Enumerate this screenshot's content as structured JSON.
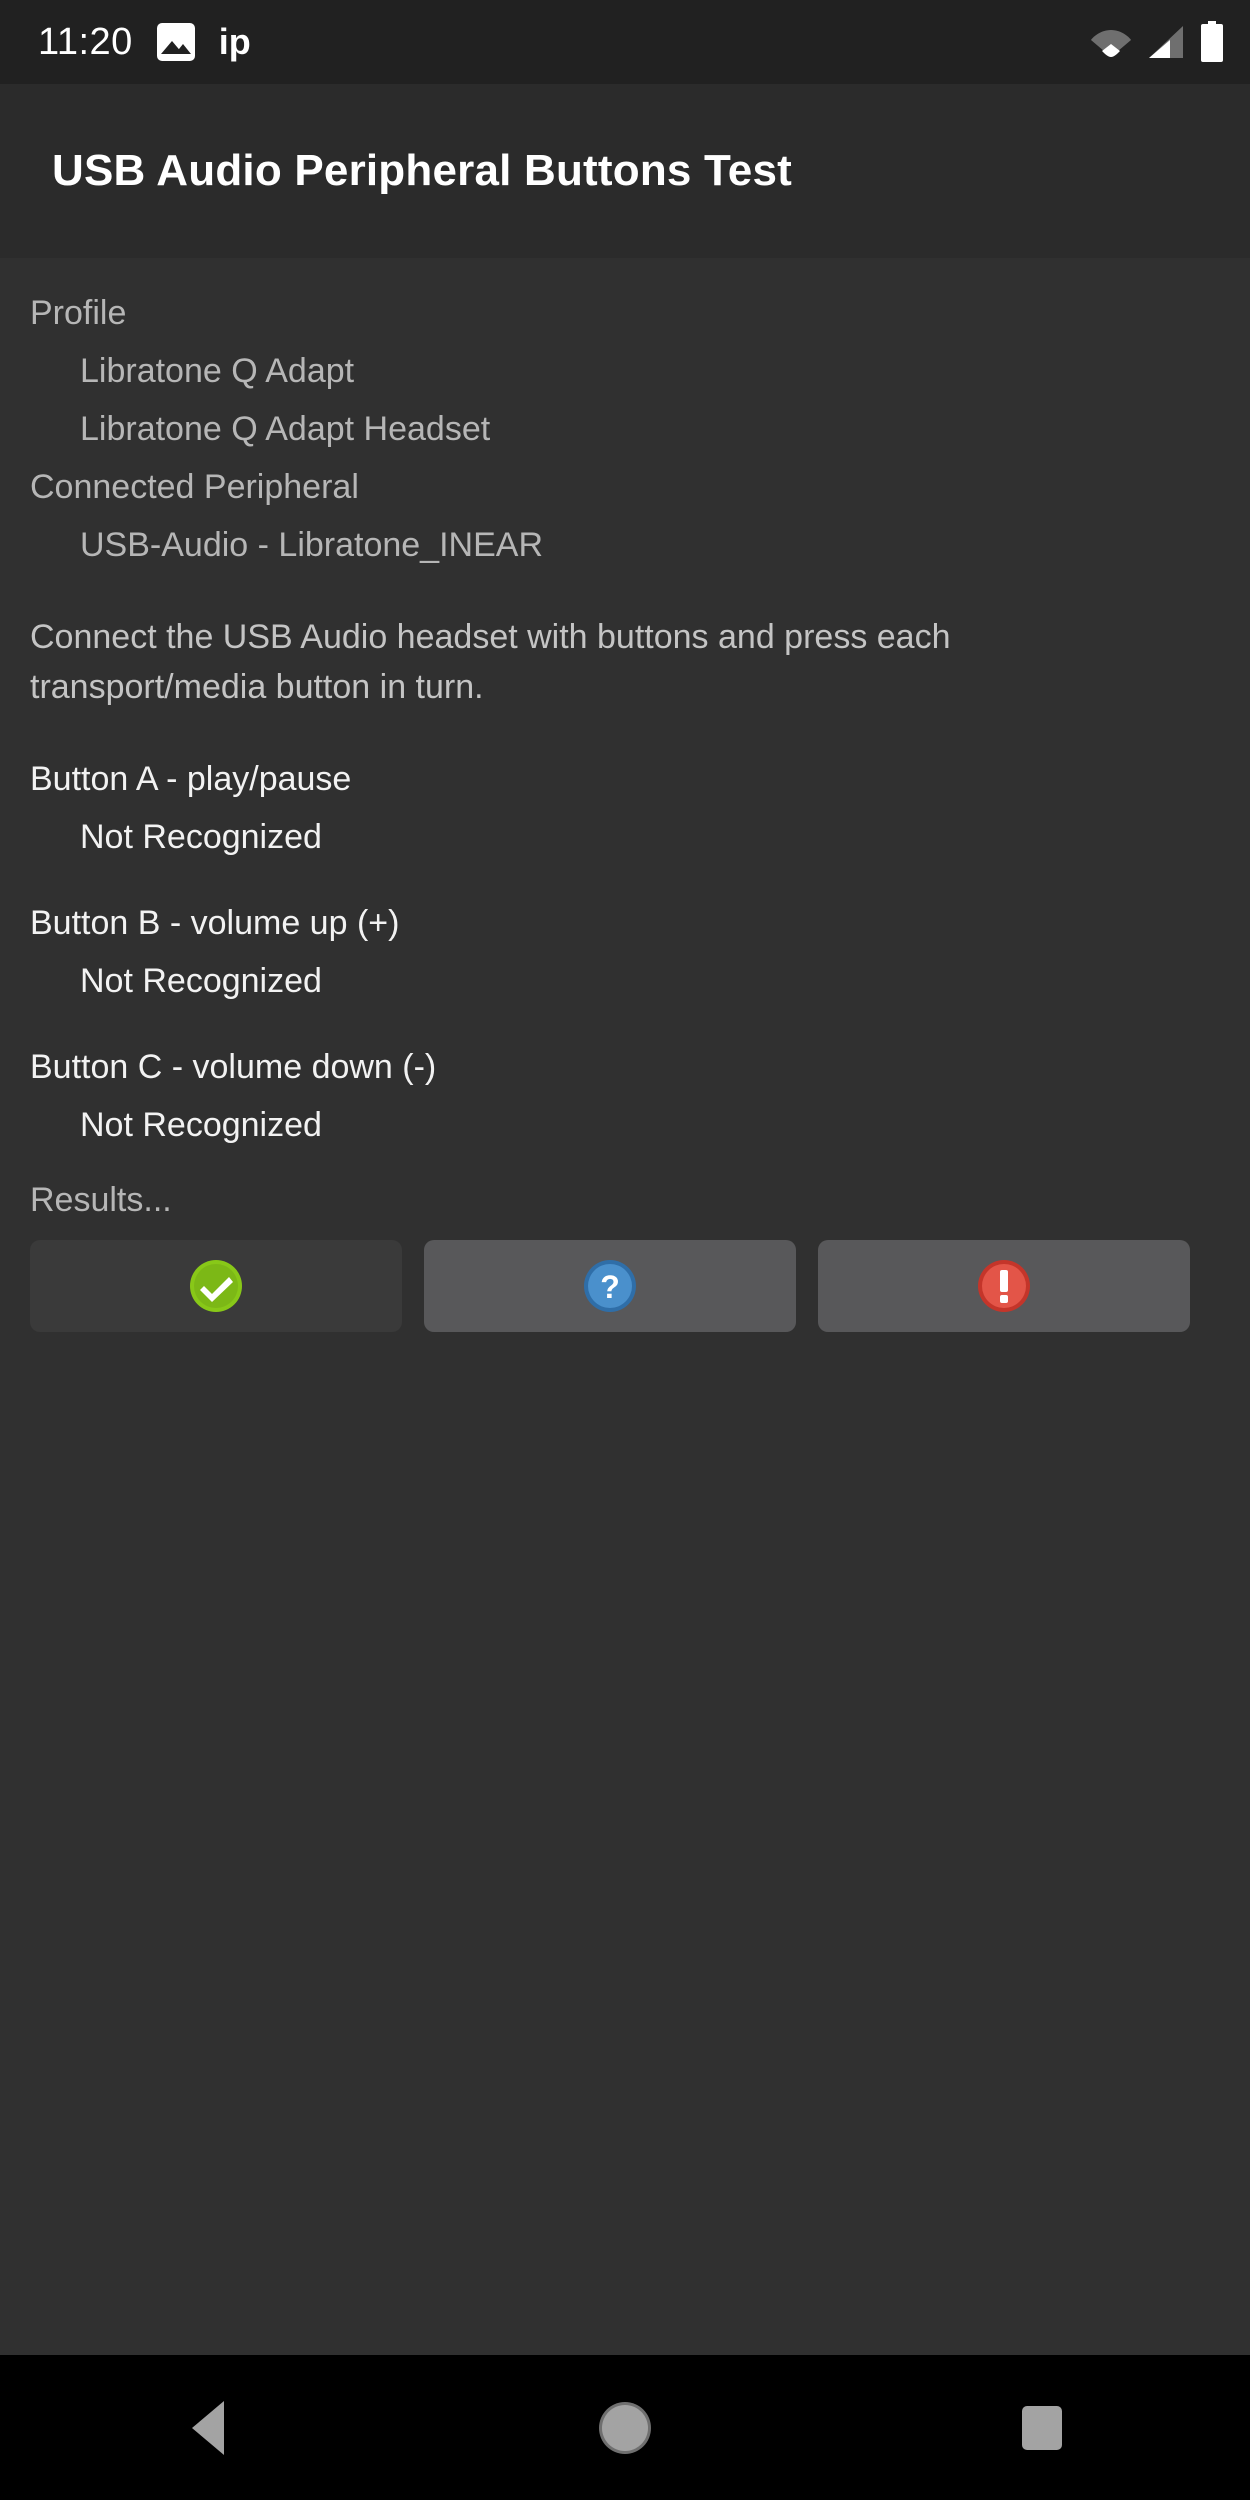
{
  "status_bar": {
    "clock": "11:20",
    "ip_label": "ip",
    "icons": [
      "photo-icon",
      "wifi-icon",
      "cellular-signal-icon",
      "battery-icon"
    ]
  },
  "header": {
    "title": "USB Audio Peripheral Buttons Test"
  },
  "profile": {
    "heading": "Profile",
    "items": [
      "Libratone Q Adapt",
      "Libratone Q Adapt Headset"
    ]
  },
  "connected_peripheral": {
    "heading": "Connected Peripheral",
    "value": "USB-Audio - Libratone_INEAR"
  },
  "instructions": "Connect the USB Audio headset with buttons and press each transport/media button in turn.",
  "button_tests": [
    {
      "label": "Button A - play/pause",
      "status": "Not Recognized"
    },
    {
      "label": "Button B - volume up (+)",
      "status": "Not Recognized"
    },
    {
      "label": "Button C - volume down (-)",
      "status": "Not Recognized"
    }
  ],
  "results": {
    "label": "Results...",
    "buttons": [
      {
        "name": "pass-button",
        "icon": "check-circle-icon",
        "state": "disabled",
        "color": "#7cb816"
      },
      {
        "name": "info-button",
        "icon": "question-circle-icon",
        "state": "enabled",
        "color": "#3f87c8"
      },
      {
        "name": "fail-button",
        "icon": "exclamation-circle-icon",
        "state": "enabled",
        "color": "#e04b3c"
      }
    ]
  },
  "nav_bar": {
    "back": "back-triangle-icon",
    "home": "home-circle-icon",
    "recents": "recents-square-icon"
  },
  "colors": {
    "background": "#303030",
    "action_bar": "#2b2b2b",
    "status_bar": "#212121",
    "nav_bar": "#000000",
    "text_dim": "#b6b6b6",
    "text_bright": "#f2f2f2"
  }
}
